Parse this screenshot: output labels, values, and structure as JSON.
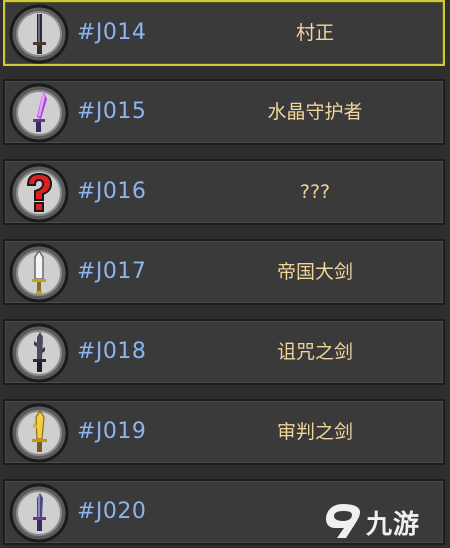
{
  "entries": [
    {
      "code": "#J014",
      "name": "村正",
      "icon": "dark-blade-icon",
      "selected": true
    },
    {
      "code": "#J015",
      "name": "水晶守护者",
      "icon": "crystal-sword-icon",
      "selected": false
    },
    {
      "code": "#J016",
      "name": "???",
      "icon": "unknown-question-icon",
      "selected": false
    },
    {
      "code": "#J017",
      "name": "帝国大剑",
      "icon": "imperial-greatsword-icon",
      "selected": false
    },
    {
      "code": "#J018",
      "name": "诅咒之剑",
      "icon": "cursed-sword-icon",
      "selected": false
    },
    {
      "code": "#J019",
      "name": "审判之剑",
      "icon": "judgment-sword-icon",
      "selected": false
    },
    {
      "code": "#J020",
      "name": "",
      "icon": "purple-dagger-icon",
      "selected": false
    }
  ],
  "watermark": {
    "text": "九游",
    "icon": "jiuyou-logo-icon"
  },
  "colors": {
    "background": "#2e2e2e",
    "row_fill": "#3a3a3a",
    "selected_border": "#cfc83a",
    "code_text": "#8cb4f0",
    "name_text": "#f0d49a",
    "question_mark": "#e02020"
  }
}
